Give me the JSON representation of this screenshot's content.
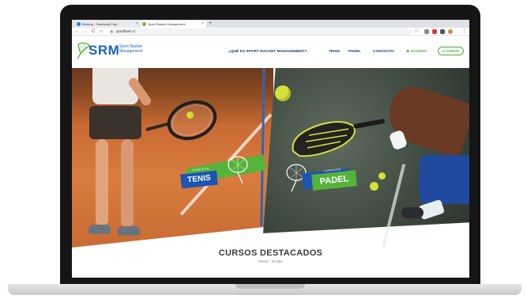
{
  "browser": {
    "tabs": [
      {
        "label": "Mockup - Facebook Post"
      },
      {
        "label": "Sport Racket Management"
      }
    ],
    "new_tab": "+",
    "nav": {
      "back": "←",
      "forward": "→",
      "reload": "C",
      "home": "⌂"
    },
    "url": "sportflaez.cl",
    "menu": "⋮"
  },
  "site": {
    "logo": {
      "mark": "SRM",
      "subtitle_line1": "Sport Racket",
      "subtitle_line2": "Management"
    },
    "nav": {
      "que_es": "¿QUÉ ES SPORT RACKET MANAGEMENT?",
      "tenis": "TENIS",
      "padel": "PADEL",
      "contacto": "CONTACTO",
      "acceso": "♟ ACCESO",
      "cuenta": "⊙ CUENTA"
    },
    "colors": {
      "brand_blue": "#1c63b6",
      "brand_green": "#4daa30"
    }
  },
  "hero": {
    "tenis": {
      "small": "FORMACIÓN",
      "label": "TENIS"
    },
    "padel": {
      "small": "FORMACIÓN",
      "label": "PADEL"
    }
  },
  "section": {
    "title": "CURSOS DESTACADOS",
    "subtitle": "TENIS · PADEL"
  },
  "icons": [
    "srm-logo-icon",
    "racket-icon",
    "lock-icon",
    "star-icon"
  ]
}
